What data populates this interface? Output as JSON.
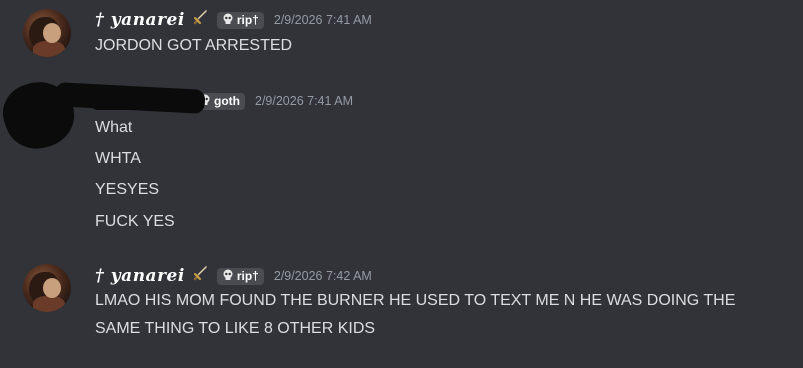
{
  "messages": [
    {
      "username": "† yanarei",
      "tag": "rip†",
      "timestamp": "2/9/2026 7:41 AM",
      "lines": [
        "JORDON GOT ARRESTED"
      ]
    },
    {
      "username": "",
      "tag": "goth",
      "timestamp": "2/9/2026 7:41 AM",
      "lines": [
        "What",
        "WHTA",
        "YESYES",
        "FUCK YES"
      ]
    },
    {
      "username": "† yanarei",
      "tag": "rip†",
      "timestamp": "2/9/2026 7:42 AM",
      "lines": [
        "LMAO HIS MOM FOUND THE BURNER HE USED TO TEXT ME N HE WAS DOING THE",
        "SAME THING TO LIKE 8 OTHER KIDS"
      ]
    }
  ],
  "icons": {
    "dagger": "dagger-icon",
    "skull": "skull-icon"
  },
  "colors": {
    "background": "#313338",
    "message_text": "#dbdee1",
    "timestamp": "#949ba4",
    "tag_bg": "#4a4c52"
  }
}
